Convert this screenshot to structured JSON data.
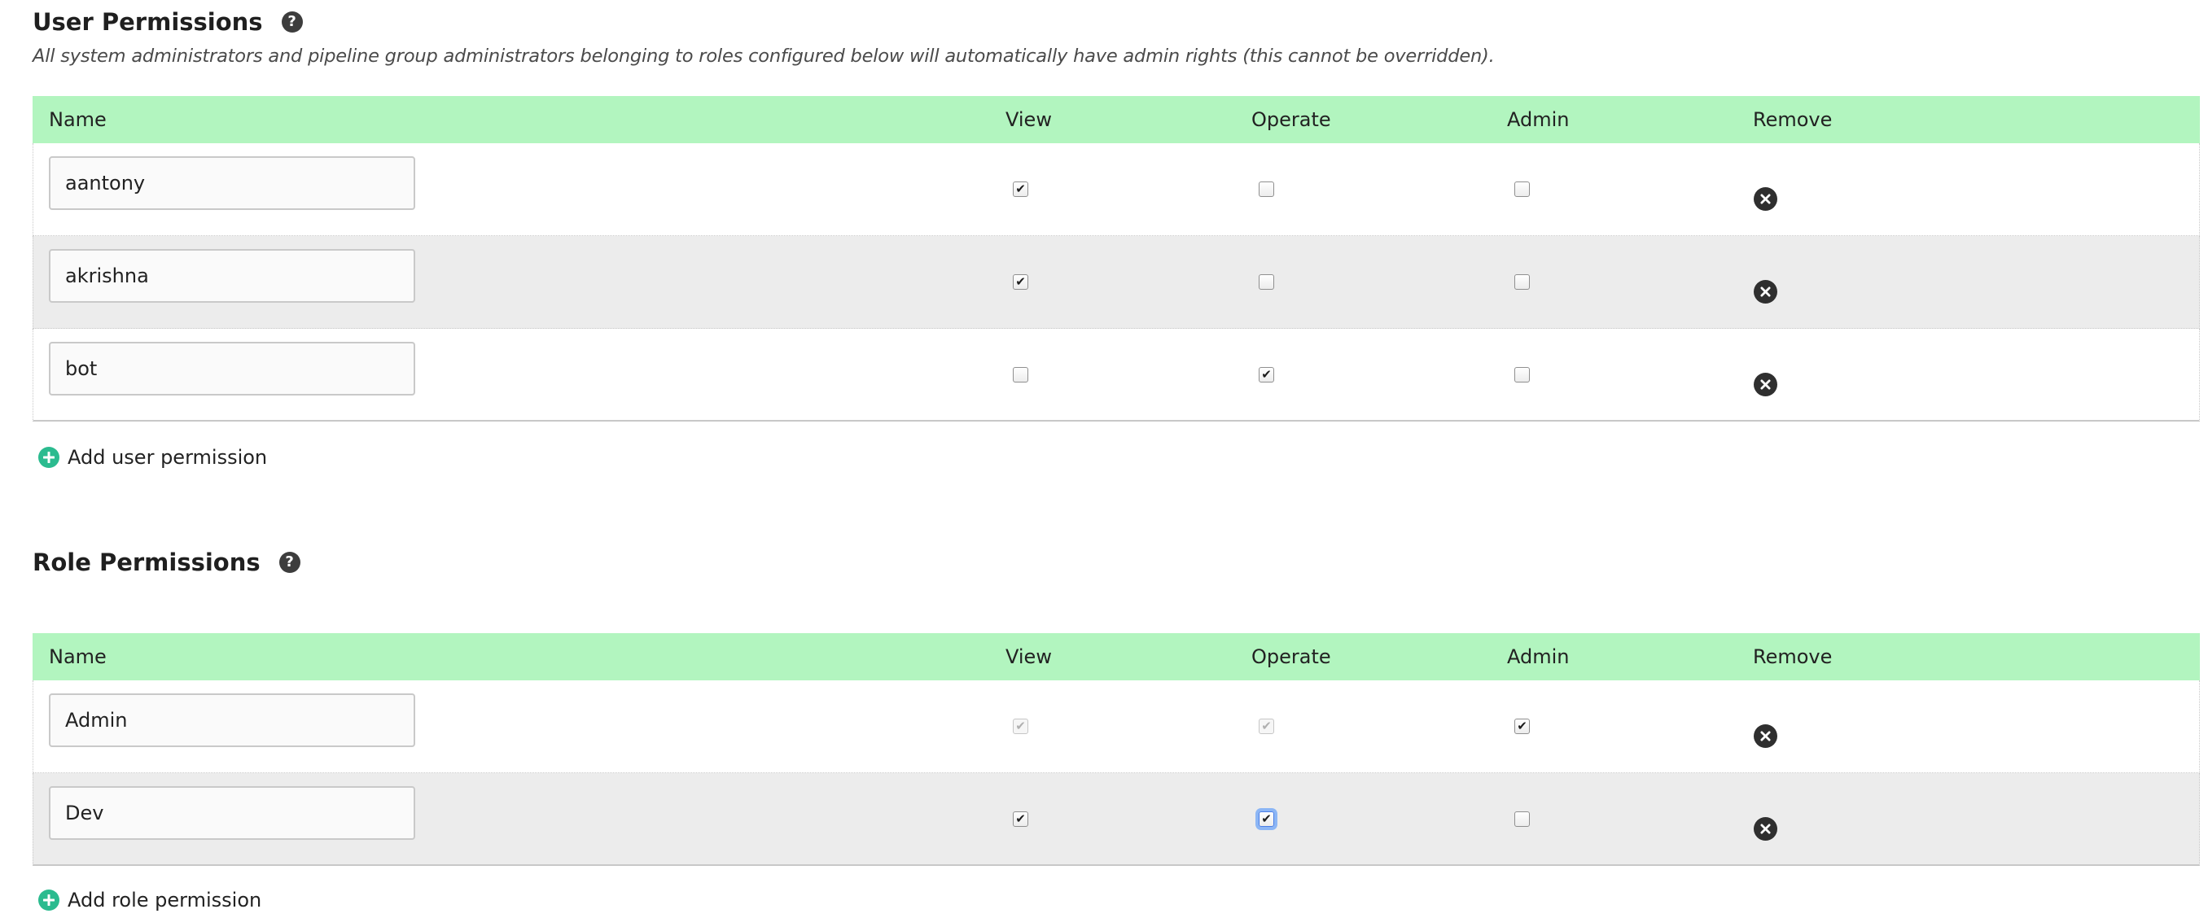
{
  "user_permissions": {
    "title": "User Permissions",
    "help_icon": "question-circle-icon",
    "note": "All system administrators and pipeline group administrators belonging to roles configured below will automatically have admin rights (this cannot be overridden).",
    "headers": {
      "name": "Name",
      "view": "View",
      "operate": "Operate",
      "admin": "Admin",
      "remove": "Remove"
    },
    "rows": [
      {
        "name": "aantony",
        "view": true,
        "operate": false,
        "admin": false
      },
      {
        "name": "akrishna",
        "view": true,
        "operate": false,
        "admin": false
      },
      {
        "name": "bot",
        "view": false,
        "operate": true,
        "admin": false
      }
    ],
    "add_label": "Add user permission"
  },
  "role_permissions": {
    "title": "Role Permissions",
    "help_icon": "question-circle-icon",
    "headers": {
      "name": "Name",
      "view": "View",
      "operate": "Operate",
      "admin": "Admin",
      "remove": "Remove"
    },
    "rows": [
      {
        "name": "Admin",
        "view": true,
        "operate": true,
        "admin": true,
        "view_disabled": true,
        "operate_disabled": true
      },
      {
        "name": "Dev",
        "view": true,
        "operate": true,
        "admin": false,
        "operate_focused": true
      }
    ],
    "add_label": "Add role permission"
  },
  "colors": {
    "header_bg": "#b2f5bf",
    "alt_row_bg": "#ececec",
    "add_icon": "#2bbb8f",
    "remove_icon": "#2f2f2f",
    "focus_ring": "#8cb6f5"
  },
  "icons": {
    "remove": "times-circle-icon",
    "add": "plus-circle-icon",
    "check": "checkmark-icon"
  }
}
